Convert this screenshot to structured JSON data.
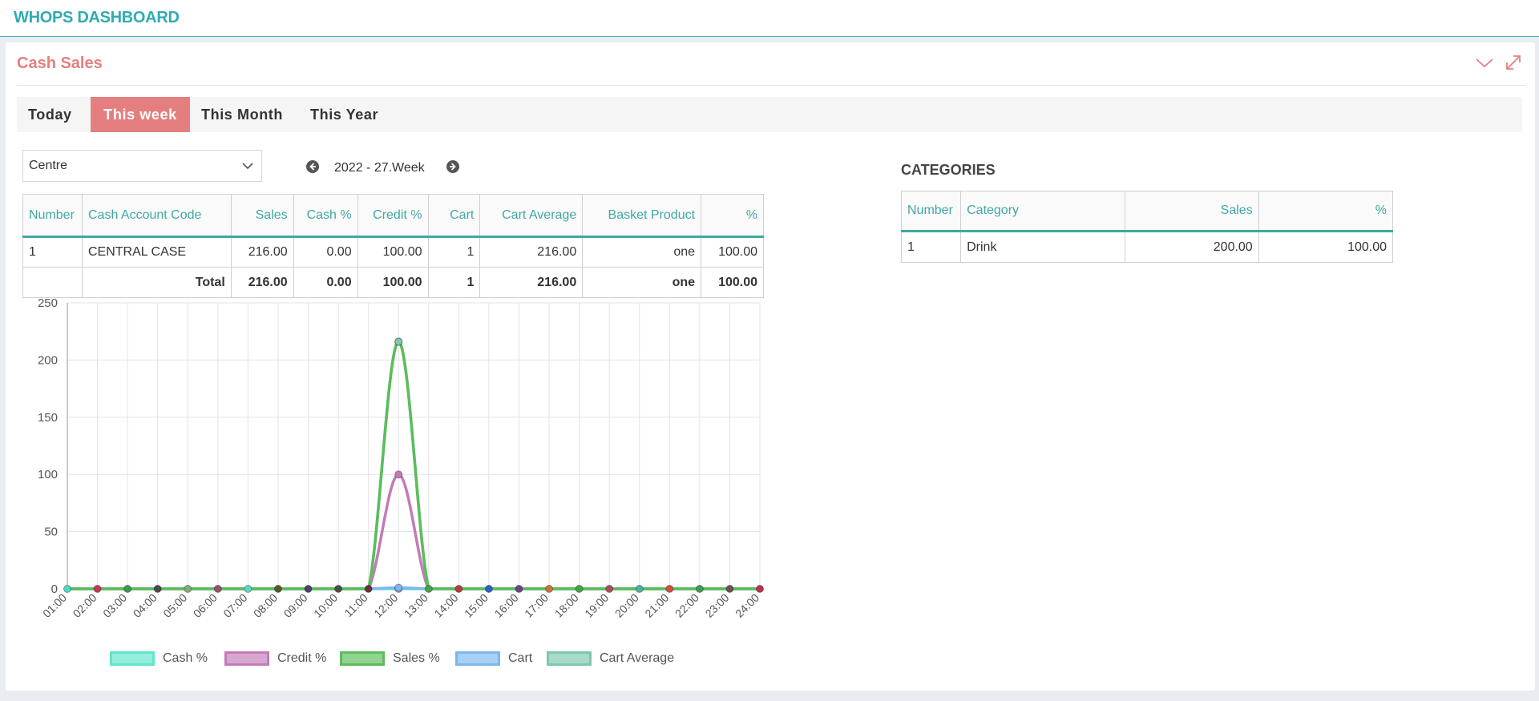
{
  "app": {
    "title": "WHOPS DASHBOARD"
  },
  "panel": {
    "title": "Cash Sales",
    "tools": [
      {
        "name": "collapse-icon"
      },
      {
        "name": "expand-icon"
      }
    ]
  },
  "tabs": [
    {
      "label": "Today",
      "active": false
    },
    {
      "label": "This week",
      "active": true
    },
    {
      "label": "This Month",
      "active": false
    },
    {
      "label": "This Year",
      "active": false
    }
  ],
  "filter": {
    "selected": "Centre"
  },
  "week_nav": {
    "label": "2022 - 27.Week"
  },
  "sales_table": {
    "headers": [
      "Number",
      "Cash Account Code",
      "Sales",
      "Cash %",
      "Credit %",
      "Cart",
      "Cart Average",
      "Basket Product",
      "%"
    ],
    "rows": [
      [
        "1",
        "CENTRAL CASE",
        "216.00",
        "0.00",
        "100.00",
        "1",
        "216.00",
        "one",
        "100.00"
      ]
    ],
    "total": [
      "",
      "Total",
      "216.00",
      "0.00",
      "100.00",
      "1",
      "216.00",
      "one",
      "100.00"
    ]
  },
  "categories": {
    "title": "CATEGORIES",
    "headers": [
      "Number",
      "Category",
      "Sales",
      "%"
    ],
    "rows": [
      [
        "1",
        "Drink",
        "200.00",
        "100.00"
      ]
    ]
  },
  "chart_data": {
    "type": "line",
    "x": [
      "01:00",
      "02:00",
      "03:00",
      "04:00",
      "05:00",
      "06:00",
      "07:00",
      "08:00",
      "09:00",
      "10:00",
      "11:00",
      "12:00",
      "13:00",
      "14:00",
      "15:00",
      "16:00",
      "17:00",
      "18:00",
      "19:00",
      "20:00",
      "21:00",
      "22:00",
      "23:00",
      "24:00"
    ],
    "ylim": [
      0,
      250
    ],
    "yticks": [
      0,
      50,
      100,
      150,
      200,
      250
    ],
    "grid": true,
    "legend_position": "bottom",
    "series": [
      {
        "name": "Cash  %",
        "color": "#5fe6cc",
        "values": [
          0,
          0,
          0,
          0,
          0,
          0,
          0,
          0,
          0,
          0,
          0,
          0,
          0,
          0,
          0,
          0,
          0,
          0,
          0,
          0,
          0,
          0,
          0,
          0
        ]
      },
      {
        "name": "Credit  %",
        "color": "#c37bb8",
        "values": [
          0,
          0,
          0,
          0,
          0,
          0,
          0,
          0,
          0,
          0,
          0,
          100,
          0,
          0,
          0,
          0,
          0,
          0,
          0,
          0,
          0,
          0,
          0,
          0
        ]
      },
      {
        "name": "Sales  %",
        "color": "#5bbd5b",
        "values": [
          0,
          0,
          0,
          0,
          0,
          0,
          0,
          0,
          0,
          0,
          0,
          216,
          0,
          0,
          0,
          0,
          0,
          0,
          0,
          0,
          0,
          0,
          0,
          0
        ]
      },
      {
        "name": "Cart",
        "color": "#7db7ef",
        "values": [
          0,
          0,
          0,
          0,
          0,
          0,
          0,
          0,
          0,
          0,
          0,
          1,
          0,
          0,
          0,
          0,
          0,
          0,
          0,
          0,
          0,
          0,
          0,
          0
        ]
      },
      {
        "name": "Cart Average",
        "color": "#7cc8b1",
        "values": [
          0,
          0,
          0,
          0,
          0,
          0,
          0,
          0,
          0,
          0,
          0,
          216,
          0,
          0,
          0,
          0,
          0,
          0,
          0,
          0,
          0,
          0,
          0,
          0
        ]
      }
    ]
  }
}
